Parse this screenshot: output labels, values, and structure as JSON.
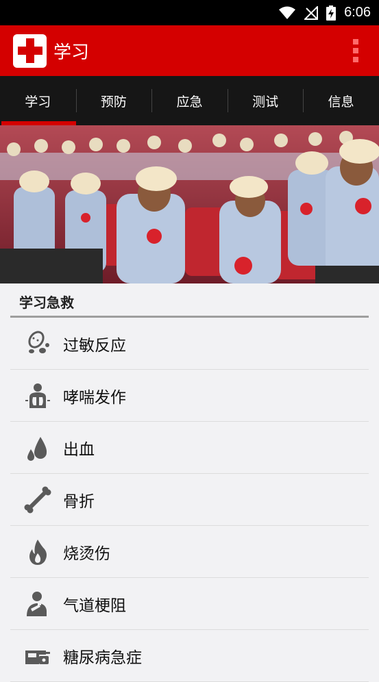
{
  "status_bar": {
    "time": "6:06"
  },
  "app_bar": {
    "title": "学习"
  },
  "tabs": [
    {
      "label": "学习",
      "active": true
    },
    {
      "label": "预防",
      "active": false
    },
    {
      "label": "应急",
      "active": false
    },
    {
      "label": "测试",
      "active": false
    },
    {
      "label": "信息",
      "active": false
    }
  ],
  "section": {
    "title": "学习急救"
  },
  "items": [
    {
      "label": "过敏反应",
      "icon": "peanut-icon"
    },
    {
      "label": "哮喘发作",
      "icon": "lungs-icon"
    },
    {
      "label": "出血",
      "icon": "blood-drop-icon"
    },
    {
      "label": "骨折",
      "icon": "bone-icon"
    },
    {
      "label": "烧烫伤",
      "icon": "flame-icon"
    },
    {
      "label": "气道梗阻",
      "icon": "choking-icon"
    },
    {
      "label": "糖尿病急症",
      "icon": "glucose-meter-icon"
    }
  ],
  "colors": {
    "brand_red": "#d40000",
    "tab_bg": "#161616",
    "list_bg": "#f2f2f4"
  }
}
